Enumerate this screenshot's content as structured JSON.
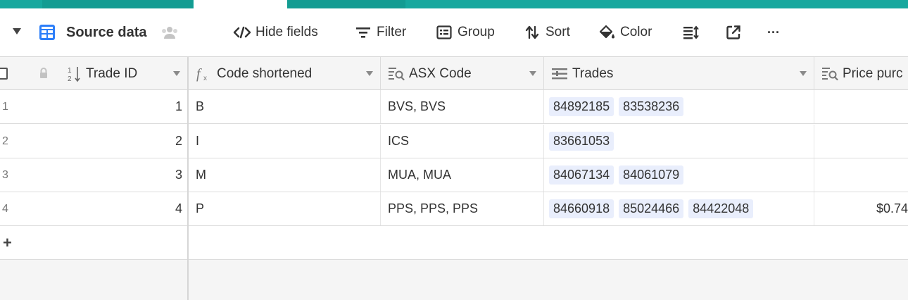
{
  "toolbar": {
    "view_name": "Source data",
    "hide_fields": "Hide fields",
    "filter": "Filter",
    "group": "Group",
    "sort": "Sort",
    "color": "Color",
    "more": "···"
  },
  "colors": {
    "accent": "#17a89e",
    "grid_blue": "#2d7ff9",
    "pill_bg": "#e9eefc",
    "header_bg": "#f5f5f5"
  },
  "columns": {
    "trade_id": "Trade ID",
    "code_shortened": "Code shortened",
    "asx_code": "ASX Code",
    "trades": "Trades",
    "price": "Price purc"
  },
  "rows": [
    {
      "num": "1",
      "trade_id": "1",
      "code": "B",
      "asx": "BVS, BVS",
      "trades": [
        "84892185",
        "83538236"
      ],
      "price": ""
    },
    {
      "num": "2",
      "trade_id": "2",
      "code": "I",
      "asx": "ICS",
      "trades": [
        "83661053"
      ],
      "price": ""
    },
    {
      "num": "3",
      "trade_id": "3",
      "code": "M",
      "asx": "MUA, MUA",
      "trades": [
        "84067134",
        "84061079"
      ],
      "price": ""
    },
    {
      "num": "4",
      "trade_id": "4",
      "code": "P",
      "asx": "PPS, PPS, PPS",
      "trades": [
        "84660918",
        "85024466",
        "84422048"
      ],
      "price": "$0.74"
    }
  ],
  "add_row": "+"
}
